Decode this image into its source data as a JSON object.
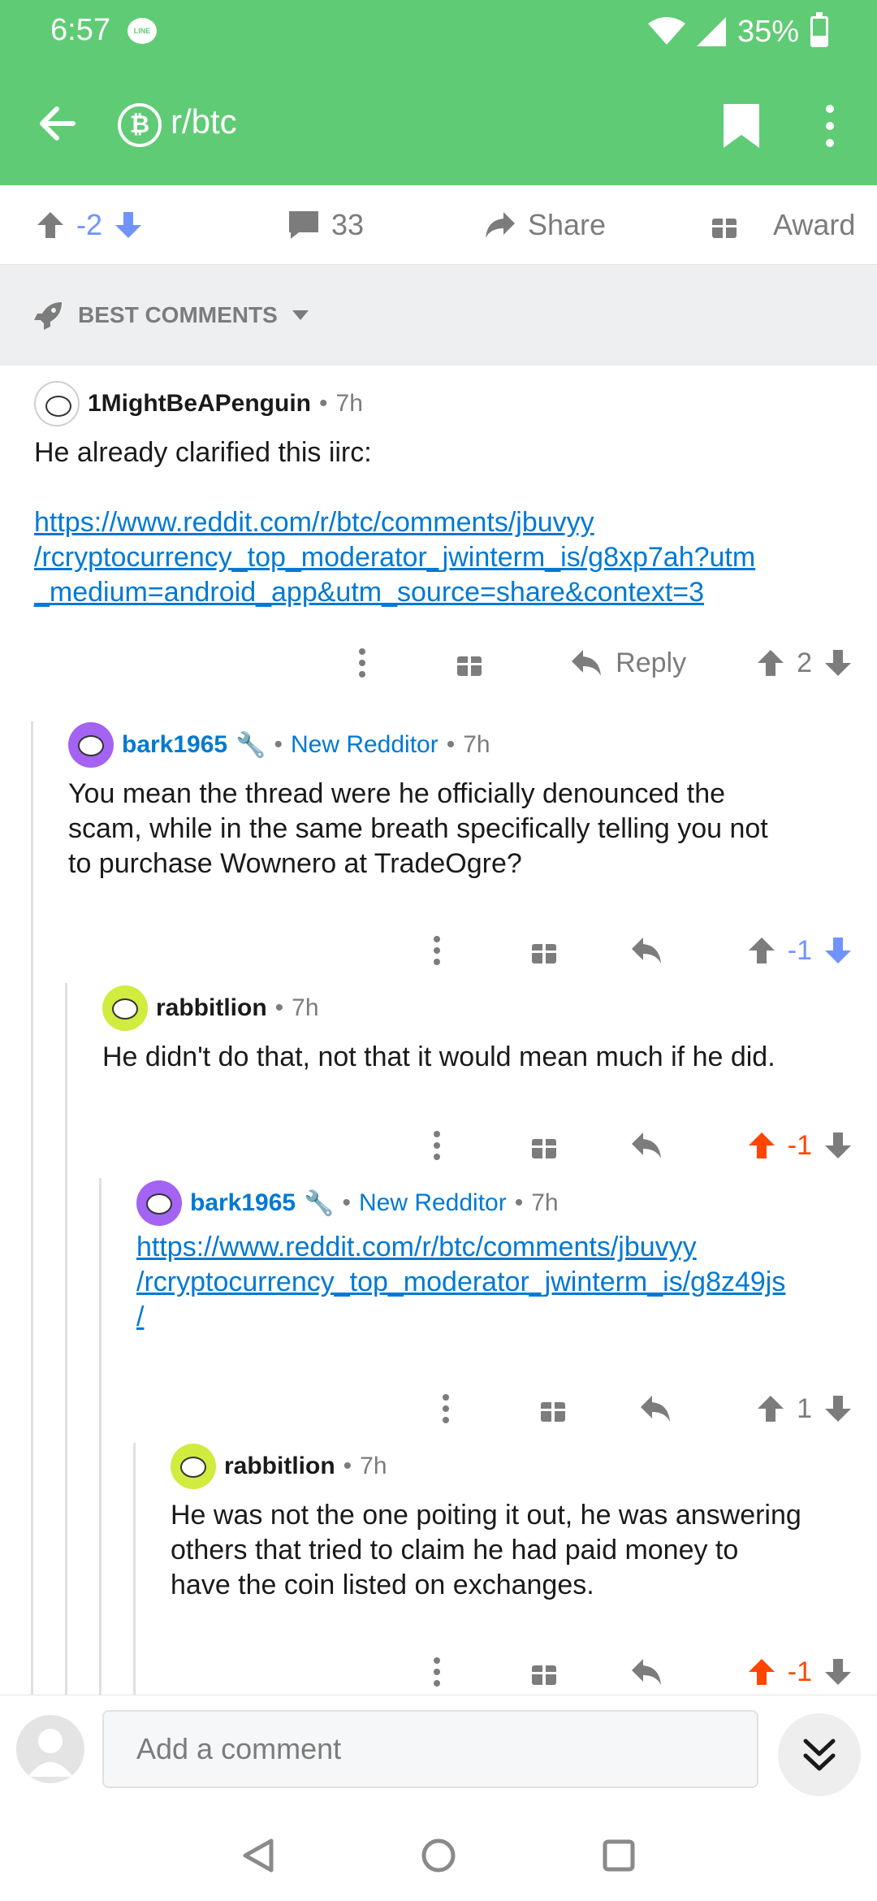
{
  "status_bar": {
    "time": "6:57",
    "line_label": "LINE",
    "battery": "35%"
  },
  "app_bar": {
    "subreddit": "r/btc",
    "sub_icon_glyph": "₿"
  },
  "post_actions": {
    "score": "-2",
    "comments": "33",
    "share": "Share",
    "award": "Award"
  },
  "sort": {
    "label": "BEST COMMENTS"
  },
  "comments": [
    {
      "author": "1MightBeAPenguin",
      "time": "7h",
      "text": "He already clarified this iirc:",
      "link_lines": [
        "https://www.reddit.com/r/btc/comments/jbuvyy",
        "/rcryptocurrency_top_moderator_jwinterm_is/g8xp7ah?utm",
        "_medium=android_app&utm_source=share&context=3"
      ],
      "reply": "Reply",
      "score": "2"
    },
    {
      "author": "bark1965",
      "flair": "New Redditor",
      "time": "7h",
      "text_lines": [
        "You mean the thread were he officially denounced the",
        "scam, while in the same breath specifically telling you not",
        "to purchase Wownero at TradeOgre?"
      ],
      "score": "-1"
    },
    {
      "author": "rabbitlion",
      "time": "7h",
      "text_lines": [
        "He didn't do that, not that it would mean much if he did."
      ],
      "score": "-1"
    },
    {
      "author": "bark1965",
      "flair": "New Redditor",
      "time": "7h",
      "link_lines": [
        "https://www.reddit.com/r/btc/comments/jbuvyy",
        "/rcryptocurrency_top_moderator_jwinterm_is/g8z49js",
        "/"
      ],
      "score": "1"
    },
    {
      "author": "rabbitlion",
      "time": "7h",
      "text_lines": [
        "He was not the one poiting it out, he was answering",
        "others that tried to claim he had paid money to",
        "have the coin listed on exchanges."
      ],
      "score": "-1"
    }
  ],
  "comment_bar": {
    "placeholder": "Add a comment"
  },
  "colors": {
    "app_green": "#5fcb75",
    "upvote_orange": "#ff4500",
    "downvote_blue": "#7193ff",
    "link_blue": "#0079d3"
  }
}
